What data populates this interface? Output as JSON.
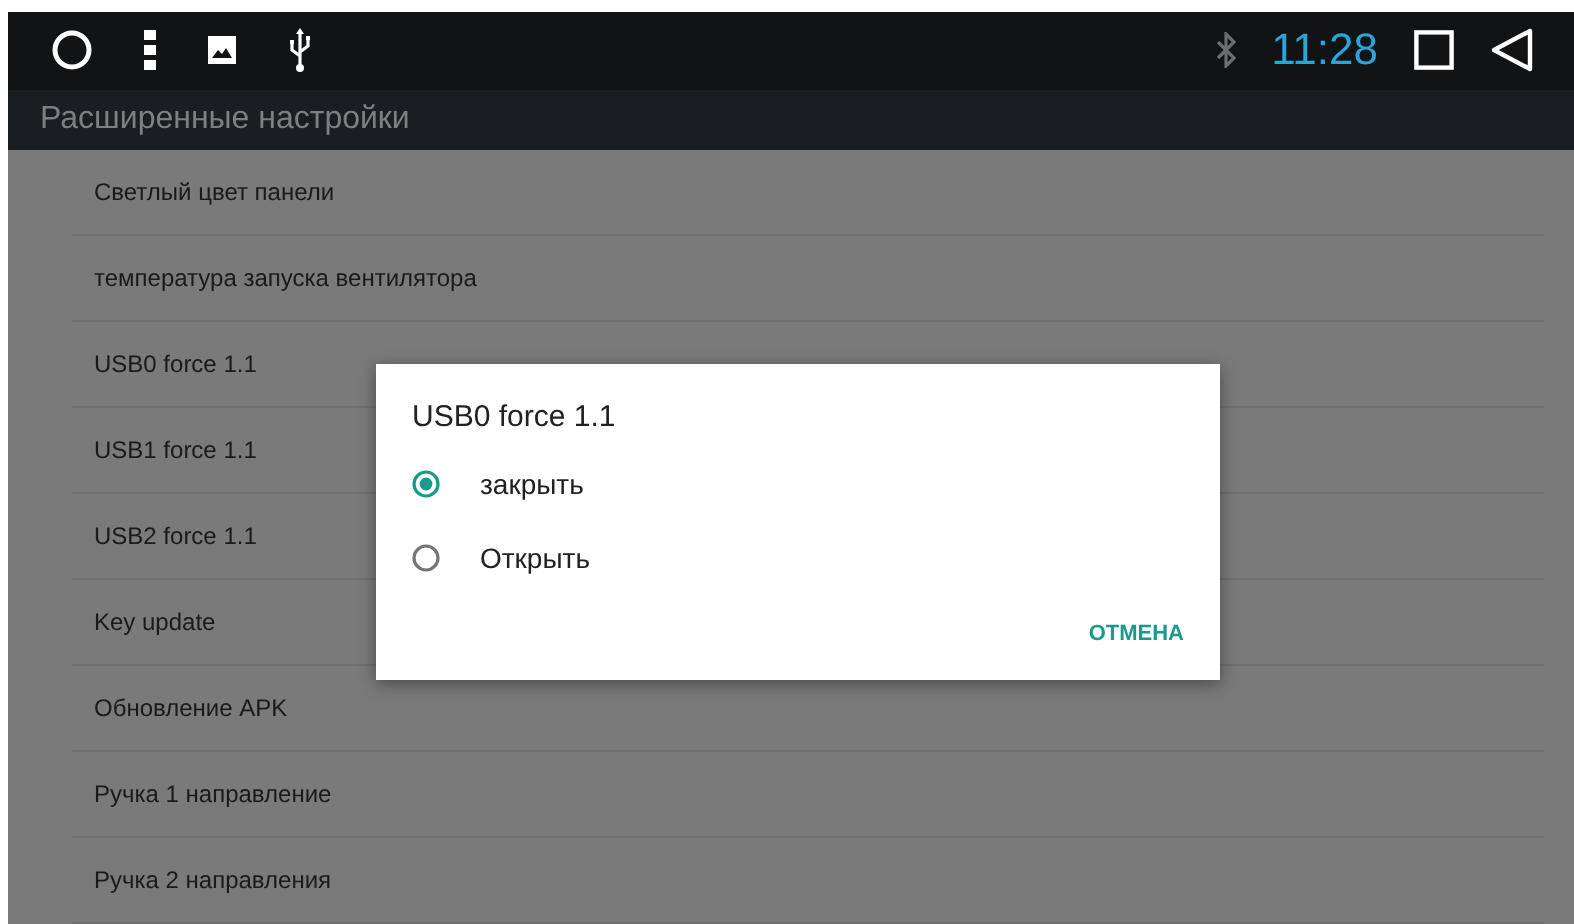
{
  "status_bar": {
    "time": "11:28"
  },
  "title_bar": {
    "title": "Расширенные настройки"
  },
  "settings": [
    {
      "label": "Светлый цвет панели"
    },
    {
      "label": "температура запуска вентилятора"
    },
    {
      "label": "USB0 force 1.1"
    },
    {
      "label": "USB1 force 1.1"
    },
    {
      "label": "USB2 force 1.1"
    },
    {
      "label": "Key update"
    },
    {
      "label": "Обновление APK"
    },
    {
      "label": "Ручка 1 направление"
    },
    {
      "label": "Ручка 2 направления"
    }
  ],
  "dialog": {
    "title": "USB0 force 1.1",
    "options": [
      {
        "label": "закрыть",
        "selected": true
      },
      {
        "label": "Открыть",
        "selected": false
      }
    ],
    "cancel": "ОТМЕНА"
  }
}
